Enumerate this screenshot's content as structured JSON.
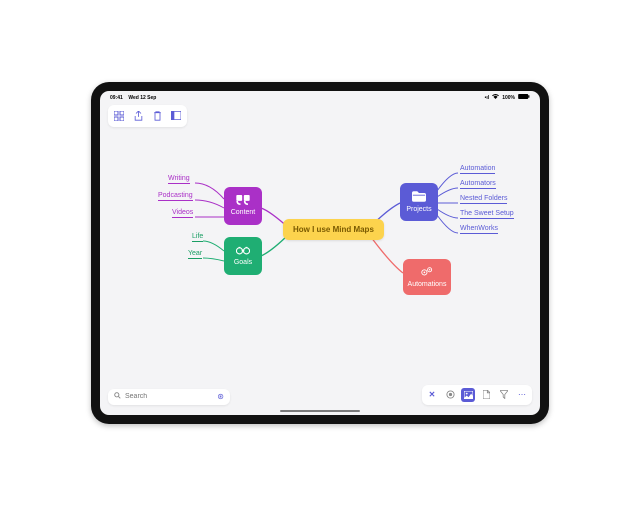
{
  "status_bar": {
    "time": "09:41",
    "date": "Wed 12 Sep",
    "wifi": "wifi-icon",
    "signal": "100%",
    "battery": "battery-icon"
  },
  "toolbar_top": {
    "buttons": [
      "grid-icon",
      "share-icon",
      "trash-icon",
      "sidebar-icon"
    ]
  },
  "mindmap": {
    "central": {
      "label": "How I use Mind Maps"
    },
    "branches": [
      {
        "key": "content",
        "label": "Content",
        "color": "#aa30c7",
        "children": [
          "Writing",
          "Podcasting",
          "Videos"
        ]
      },
      {
        "key": "goals",
        "label": "Goals",
        "color": "#1fae73",
        "children": [
          "Life",
          "Year"
        ]
      },
      {
        "key": "projects",
        "label": "Projects",
        "color": "#5b5bd6",
        "children": [
          "Automation",
          "Automators",
          "Nested Folders",
          "The Sweet Setup",
          "WhenWorks"
        ]
      },
      {
        "key": "automations",
        "label": "Automations",
        "color": "#ef6b6b",
        "children": []
      }
    ]
  },
  "search": {
    "placeholder": "Search"
  },
  "toolbar_bottom": {
    "buttons": [
      "close-icon",
      "record-icon",
      "image-icon",
      "file-icon",
      "filter-icon",
      "more-icon"
    ]
  }
}
